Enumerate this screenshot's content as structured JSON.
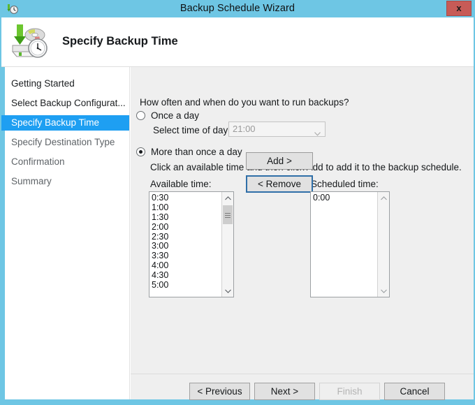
{
  "window": {
    "title": "Backup Schedule Wizard",
    "title_icon": "backup-clock-icon",
    "close_label": "x",
    "chrome_color": "#6ec6e4"
  },
  "banner": {
    "heading": "Specify Backup Time",
    "icon": "backup-disk-clock-icon"
  },
  "sidebar": {
    "accent_color": "#1e9ff2",
    "items": [
      {
        "label": "Getting Started",
        "state": "done"
      },
      {
        "label": "Select Backup Configurat...",
        "state": "done"
      },
      {
        "label": "Specify Backup Time",
        "state": "active"
      },
      {
        "label": "Specify Destination Type",
        "state": "upcoming"
      },
      {
        "label": "Confirmation",
        "state": "upcoming"
      },
      {
        "label": "Summary",
        "state": "upcoming"
      }
    ]
  },
  "main": {
    "question": "How often and when do you want to run backups?",
    "once_a_day": {
      "label": "Once a day",
      "selected": false,
      "time_of_day_label": "Select time of day:",
      "time_of_day_value": "21:00",
      "enabled": false
    },
    "more_than_once": {
      "label": "More than once a day",
      "selected": true,
      "hint": "Click an available time and then click Add to add it to the backup schedule."
    },
    "available": {
      "label": "Available time:",
      "items": [
        "0:30",
        "1:00",
        "1:30",
        "2:00",
        "2:30",
        "3:00",
        "3:30",
        "4:00",
        "4:30",
        "5:00"
      ],
      "scroll_position": "near-top"
    },
    "scheduled": {
      "label": "Scheduled time:",
      "items": [
        "0:00"
      ],
      "scroll_position": "none"
    },
    "add_button": "Add >",
    "remove_button": "< Remove"
  },
  "footer": {
    "previous": "< Previous",
    "next": "Next >",
    "finish": "Finish",
    "cancel": "Cancel",
    "finish_enabled": false
  }
}
